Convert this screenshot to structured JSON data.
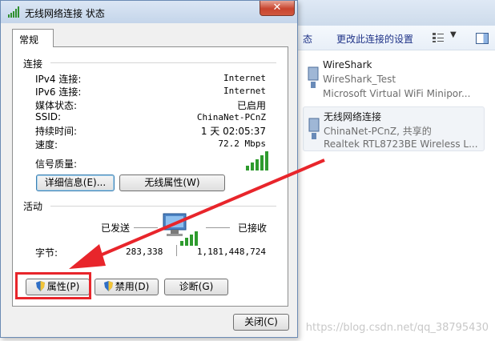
{
  "explorer": {
    "toolbar_cut": "态",
    "toolbar_change": "更改此连接的设置",
    "items": [
      {
        "name": "WireShark",
        "sub": "WireShark_Test",
        "device": "Microsoft Virtual WiFi Minipor..."
      },
      {
        "name": "无线网络连接",
        "sub": "ChinaNet-PCnZ, 共享的",
        "device": "Realtek RTL8723BE Wireless L..."
      }
    ]
  },
  "watermark": "https://blog.csdn.net/qq_38795430",
  "dialog": {
    "title": "无线网络连接 状态",
    "close_glyph": "✕",
    "tab": "常规",
    "connection": {
      "heading": "连接",
      "rows": [
        {
          "label": "IPv4 连接:",
          "value": "Internet"
        },
        {
          "label": "IPv6 连接:",
          "value": "Internet"
        },
        {
          "label": "媒体状态:",
          "value": "已启用"
        },
        {
          "label": "SSID:",
          "value": "ChinaNet-PCnZ"
        },
        {
          "label": "持续时间:",
          "value": "1 天 02:05:37"
        },
        {
          "label": "速度:",
          "value": "72.2 Mbps"
        }
      ],
      "signal_label": "信号质量:"
    },
    "buttons": {
      "details": "详细信息(E)...",
      "wireless_props": "无线属性(W)",
      "properties": "属性(P)",
      "disable": "禁用(D)",
      "diagnose": "诊断(G)",
      "close": "关闭(C)"
    },
    "activity": {
      "heading": "活动",
      "sent_label": "已发送",
      "received_label": "已接收",
      "bytes_label": "字节:",
      "bytes_sent": "283,338",
      "bytes_received": "1,181,448,724"
    }
  }
}
